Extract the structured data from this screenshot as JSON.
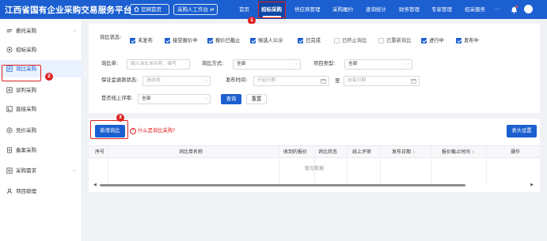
{
  "header": {
    "brand": "江西省国有企业采购交易服务平台",
    "home_button": "官网首页",
    "workbench_button": "采购人工作台 ⇄",
    "nav": [
      "首页",
      "招标采购",
      "供应商管理",
      "采购履约",
      "查询统计",
      "财务管理",
      "专家管理",
      "招采服务",
      "···"
    ],
    "active_nav": "招标采购"
  },
  "steps": [
    "1",
    "2",
    "3"
  ],
  "sidebar": {
    "items": [
      {
        "label": "委托采购",
        "icon": "delegate-icon",
        "has_children": true
      },
      {
        "label": "招标采购",
        "icon": "bid-icon",
        "has_children": false
      },
      {
        "label": "询比采购",
        "icon": "inquiry-icon",
        "has_children": false,
        "active": true
      },
      {
        "label": "谈判采购",
        "icon": "negotiate-icon",
        "has_children": false
      },
      {
        "label": "直接采购",
        "icon": "direct-icon",
        "has_children": false
      },
      {
        "label": "竞价采购",
        "icon": "auction-icon",
        "has_children": false
      },
      {
        "label": "备案采购",
        "icon": "record-icon",
        "has_children": false
      },
      {
        "label": "采购需求",
        "icon": "demand-icon",
        "has_children": true
      },
      {
        "label": "项目助理",
        "icon": "assistant-icon",
        "has_children": false
      }
    ]
  },
  "filter": {
    "status_label": "询比状态:",
    "statuses": [
      {
        "label": "未发布",
        "checked": true
      },
      {
        "label": "接受报价中",
        "checked": true
      },
      {
        "label": "报价已截止",
        "checked": true
      },
      {
        "label": "候选人公示",
        "checked": true
      },
      {
        "label": "已完成",
        "checked": true
      },
      {
        "label": "已终止询比",
        "checked": false
      },
      {
        "label": "已重新询比",
        "checked": false
      },
      {
        "label": "进行中",
        "checked": true
      },
      {
        "label": "发布中",
        "checked": true
      }
    ],
    "inquiry_label": "询比单:",
    "inquiry_placeholder": "输入询比单名称、编号",
    "method_label": "询比方式:",
    "method_value": "全部",
    "project_type_label": "项目类型:",
    "project_type_value": "全部",
    "deposit_label": "保证金退款状态:",
    "deposit_placeholder": "请选择",
    "publish_time_label": "发布时间:",
    "start_placeholder": "开始日期",
    "to_label": "至",
    "end_placeholder": "结束日期",
    "online_review_label": "是否线上评审:",
    "online_review_value": "全部",
    "search_button": "查询",
    "reset_button": "重置"
  },
  "results": {
    "add_button": "新增询比",
    "help_link": "什么是询比采购?",
    "settings_button": "表头设置",
    "columns": [
      "序号",
      "询比单名称",
      "收到的报价",
      "询比状态",
      "线上评审",
      "发布日期",
      "报价截止时间",
      "操作"
    ],
    "empty_text": "暂无数据"
  }
}
